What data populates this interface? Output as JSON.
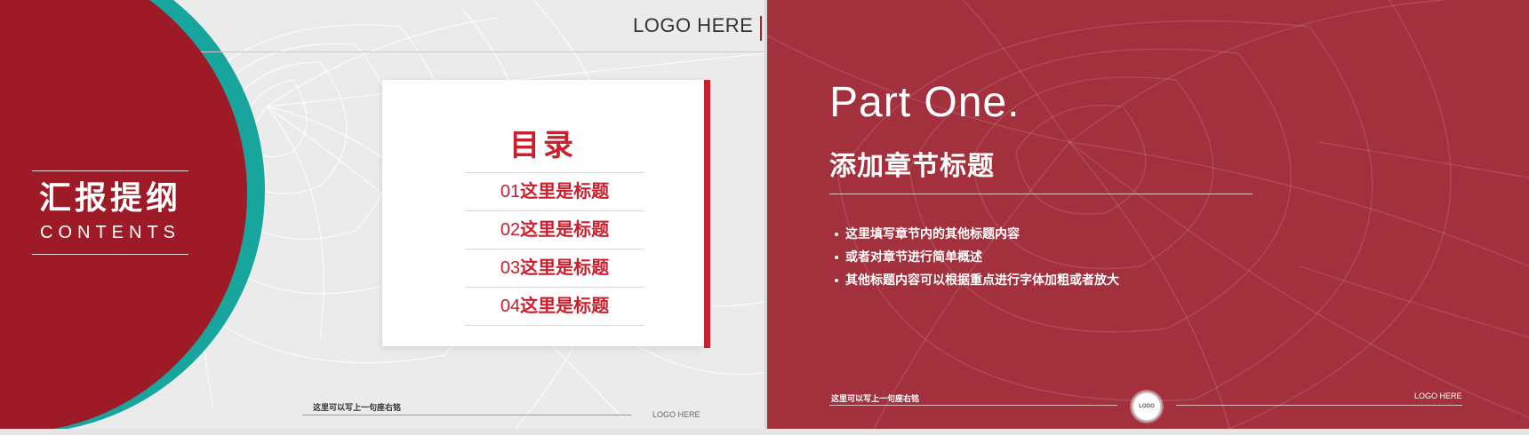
{
  "slide_left": {
    "logo": "LOGO HERE",
    "heading_cn": "汇报提纲",
    "heading_en": "CONTENTS",
    "toc_title": "目录",
    "toc": [
      {
        "num": "01",
        "label": "这里是标题"
      },
      {
        "num": "02",
        "label": "这里是标题"
      },
      {
        "num": "03",
        "label": "这里是标题"
      },
      {
        "num": "04",
        "label": "这里是标题"
      }
    ],
    "motto": "这里可以写上一句座右铭",
    "footer_logo": "LOGO HERE"
  },
  "slide_right": {
    "part_title": "Part One.",
    "chapter_title": "添加章节标题",
    "bullets": [
      "这里填写章节内的其他标题内容",
      "或者对章节进行简单概述",
      "其他标题内容可以根据重点进行字体加粗或者放大"
    ],
    "motto": "这里可以写上一句座右铭",
    "circle_logo": "LOGO",
    "footer_logo": "LOGO HERE"
  },
  "colors": {
    "brand_red": "#9e1a26",
    "accent_teal": "#17a59e",
    "text_red": "#c8202e",
    "right_bg": "#a3303d"
  }
}
